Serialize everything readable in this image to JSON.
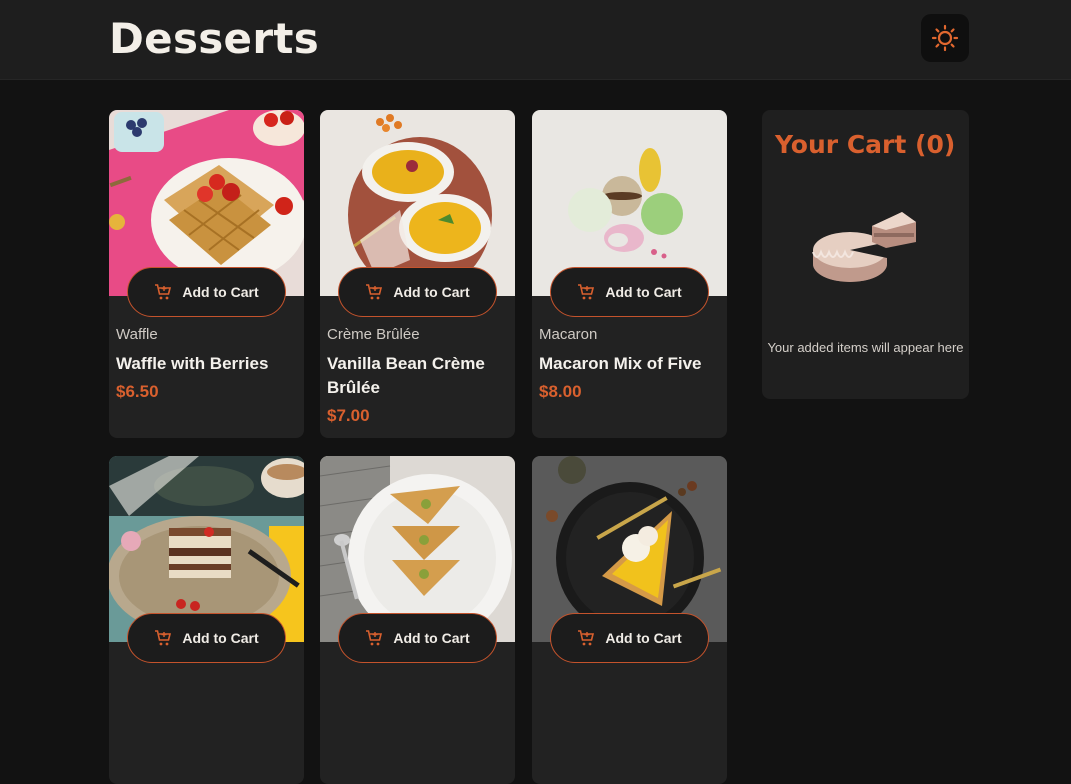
{
  "header": {
    "title": "Desserts",
    "theme_icon": "sun-icon"
  },
  "products": [
    {
      "category": "Waffle",
      "name": "Waffle with Berries",
      "price": "$6.50",
      "button": "Add to Cart"
    },
    {
      "category": "Crème Brûlée",
      "name": "Vanilla Bean Crème Brûlée",
      "price": "$7.00",
      "button": "Add to Cart"
    },
    {
      "category": "Macaron",
      "name": "Macaron Mix of Five",
      "price": "$8.00",
      "button": "Add to Cart"
    },
    {
      "button": "Add to Cart"
    },
    {
      "button": "Add to Cart"
    },
    {
      "button": "Add to Cart"
    }
  ],
  "cart": {
    "title": "Your Cart (0)",
    "empty_message": "Your added items will appear here",
    "illustration_icon": "empty-cake-icon"
  },
  "colors": {
    "accent": "#d9602e",
    "background": "#121212",
    "card": "#222222"
  }
}
